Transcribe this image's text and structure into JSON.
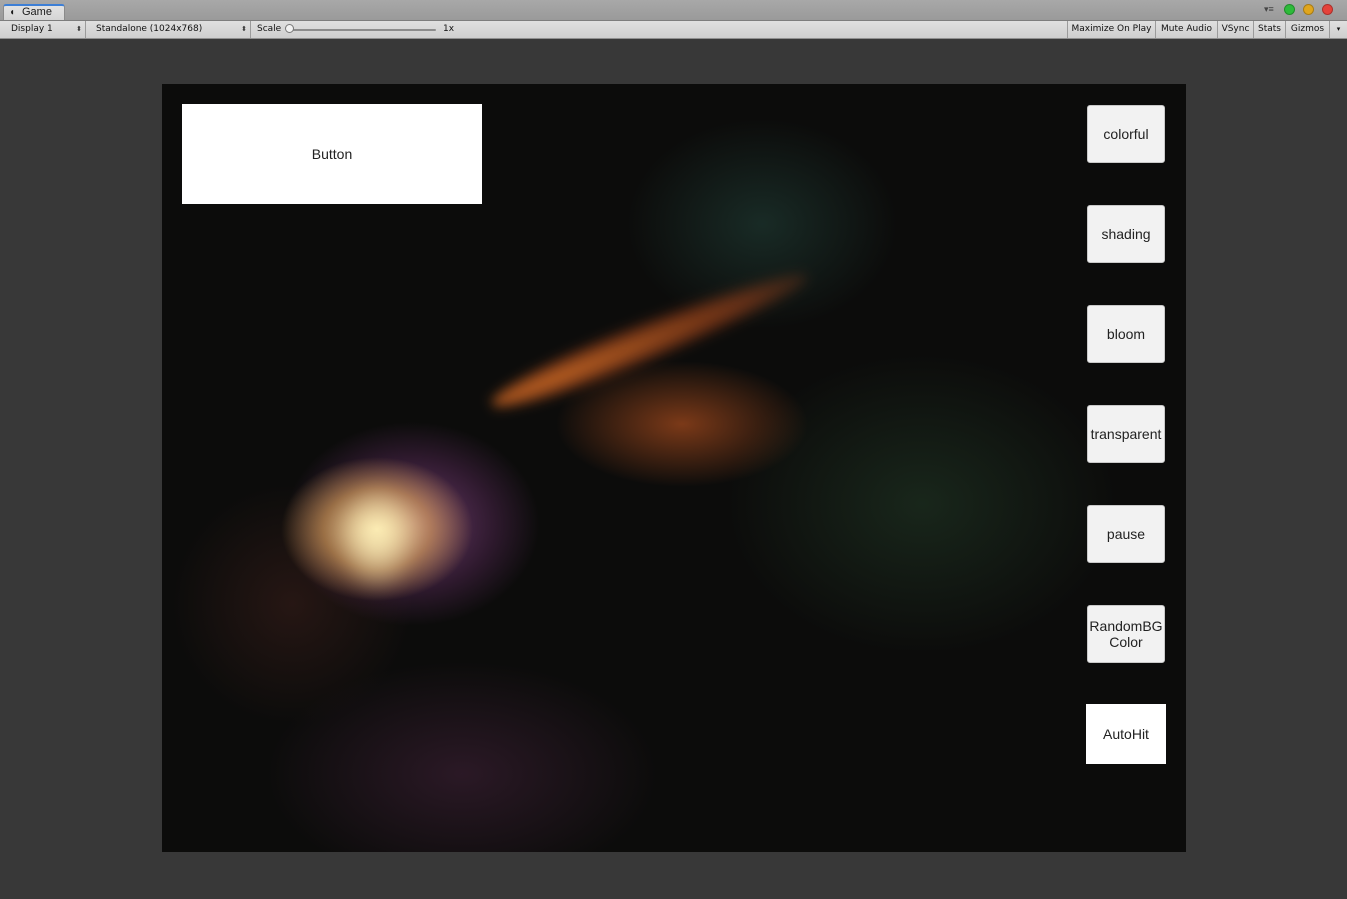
{
  "window": {
    "tab_label": "Game",
    "tab_icon": "unity-icon",
    "menu_icon": "panel-menu-icon"
  },
  "toolbar": {
    "display": "Display 1",
    "resolution": "Standalone (1024x768)",
    "scale_label": "Scale",
    "scale_value": "1x",
    "scale_level": 0,
    "maximize_on_play": "Maximize On Play",
    "mute_audio": "Mute Audio",
    "vsync": "VSync",
    "stats": "Stats",
    "gizmos": "Gizmos"
  },
  "game": {
    "main_button": "Button",
    "side_buttons": [
      {
        "label": "colorful"
      },
      {
        "label": "shading"
      },
      {
        "label": "bloom"
      },
      {
        "label": "transparent"
      },
      {
        "label": "pause"
      },
      {
        "label": "RandomBG Color"
      },
      {
        "label": "AutoHit"
      }
    ]
  },
  "colors": {
    "tab_accent": "#3d7fd6",
    "close": "#e5423a",
    "minimize": "#e0a61e",
    "zoom": "#2dbb3a",
    "editor_background": "#383838",
    "game_background": "#0c0c0b"
  }
}
